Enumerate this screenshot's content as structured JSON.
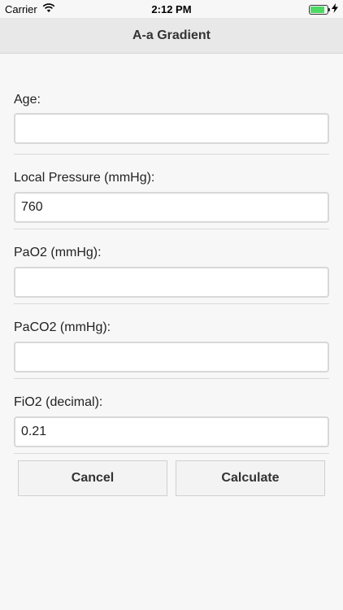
{
  "status_bar": {
    "carrier": "Carrier",
    "time": "2:12 PM",
    "icons": {
      "wifi": "wifi-icon",
      "battery": "battery-icon",
      "charging": "charging-bolt-icon"
    },
    "battery_level": 0.85,
    "battery_color": "#4cd964"
  },
  "navbar": {
    "title": "A-a Gradient"
  },
  "form": {
    "fields": [
      {
        "label": "Age:",
        "value": ""
      },
      {
        "label": "Local Pressure (mmHg):",
        "value": "760"
      },
      {
        "label": "PaO2 (mmHg):",
        "value": ""
      },
      {
        "label": "PaCO2 (mmHg):",
        "value": ""
      },
      {
        "label": "FiO2 (decimal):",
        "value": "0.21"
      }
    ]
  },
  "actions": {
    "cancel_label": "Cancel",
    "calculate_label": "Calculate"
  }
}
